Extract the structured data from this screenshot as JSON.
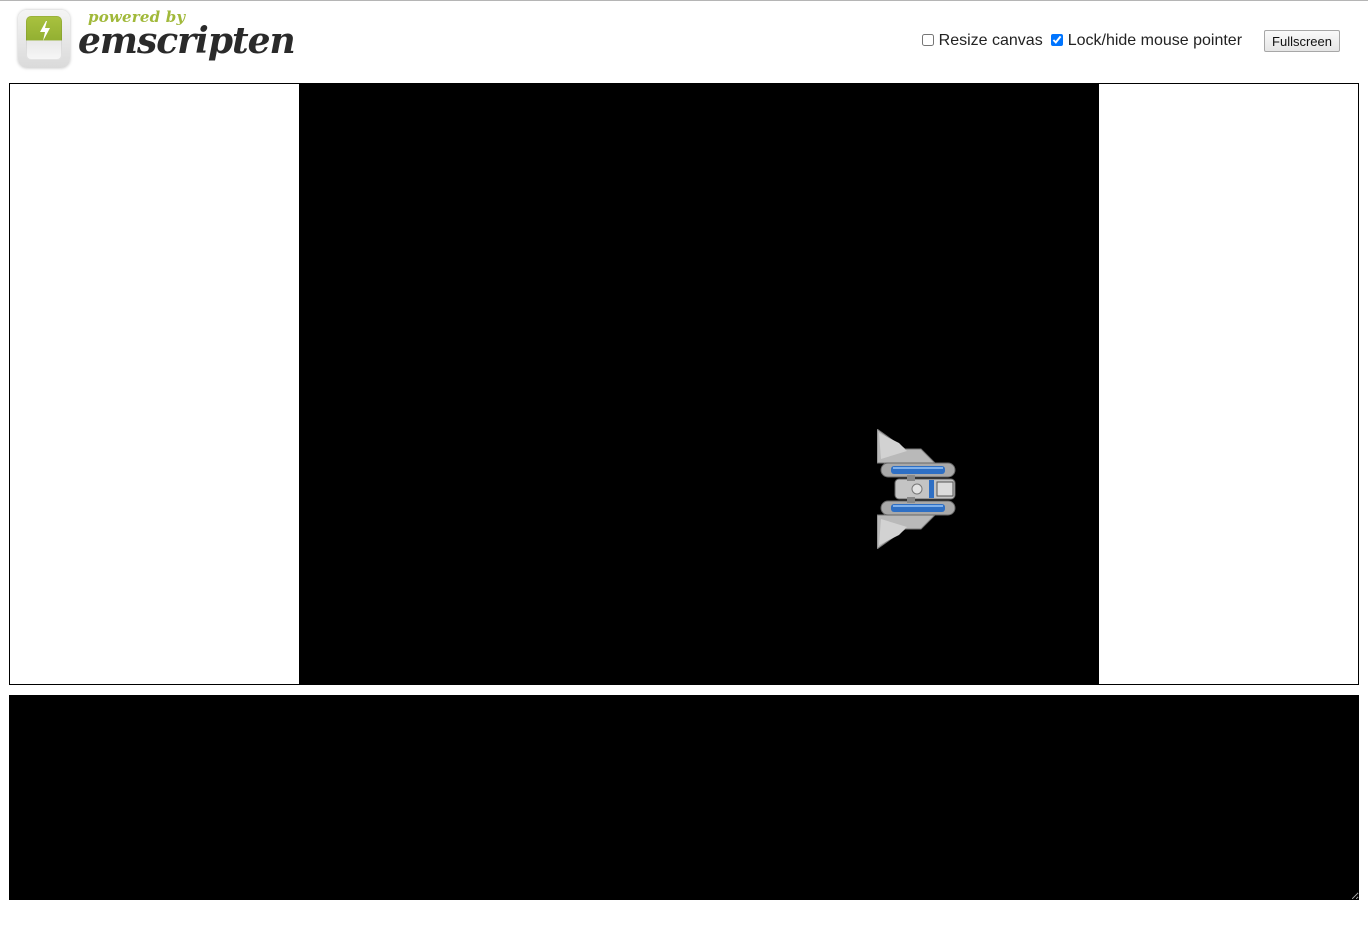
{
  "logo": {
    "powered_by": "powered by",
    "wordmark": "emscripten",
    "icon": "lightning-bolt-icon",
    "colors": {
      "accent": "#a1b93a",
      "text": "#2a2a2a"
    }
  },
  "controls": {
    "resize_canvas": {
      "label": "Resize canvas",
      "checked": false
    },
    "lock_pointer": {
      "label": "Lock/hide mouse pointer",
      "checked": true
    },
    "fullscreen_label": "Fullscreen"
  },
  "canvas": {
    "background": "#000000",
    "sprite": "spaceship-sprite"
  },
  "output": {
    "value": "",
    "background": "#000000"
  }
}
